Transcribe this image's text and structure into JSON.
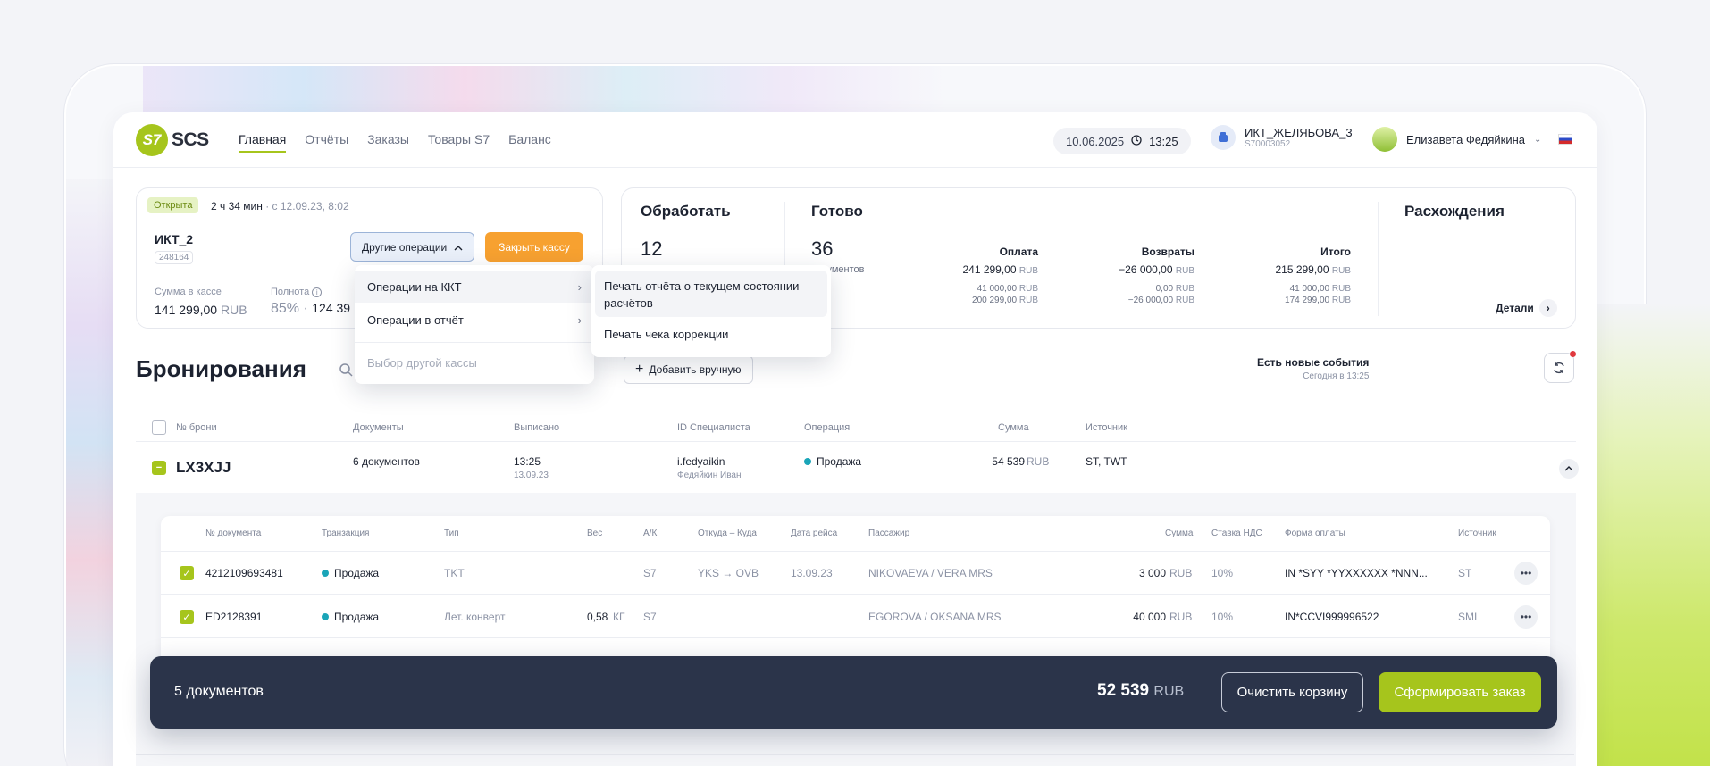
{
  "header": {
    "logo_mark": "S7",
    "logo_text": "SCS",
    "nav": [
      "Главная",
      "Отчёты",
      "Заказы",
      "Товары S7",
      "Баланс"
    ],
    "date": "10.06.2025",
    "time": "13:25",
    "kassa_name": "ИКТ_ЖЕЛЯБОВА_3",
    "kassa_id": "S70003052",
    "user_name": "Елизавета Федяйкина"
  },
  "session": {
    "status": "Открыта",
    "duration": "2 ч 34 мин",
    "since": "с 12.09.23, 8:02",
    "kassa": "ИКТ_2",
    "kassa_num": "248164",
    "other_ops": "Другие операции",
    "close_btn": "Закрыть кассу",
    "sum_label": "Сумма в кассе",
    "sum_value": "141 299,00",
    "sum_unit": "RUB",
    "full_label": "Полнота",
    "full_value": "85%",
    "full_extra": "124 39"
  },
  "stats": {
    "process_title": "Обработать",
    "process_count": "12",
    "ready_title": "Готово",
    "ready_count": "36",
    "ready_sub": "документов",
    "diff_title": "Расхождения",
    "details": "Детали",
    "columns": [
      {
        "h": "Оплата",
        "v": "241 299,00",
        "s1": "41 000,00",
        "s2": "200 299,00"
      },
      {
        "h": "Возвраты",
        "v": "−26 000,00",
        "s1": "0,00",
        "s2": "−26 000,00"
      },
      {
        "h": "Итого",
        "v": "215 299,00",
        "s1": "41 000,00",
        "s2": "174 299,00"
      }
    ],
    "unit": "RUB"
  },
  "dropdown": {
    "items": [
      "Операции на ККТ",
      "Операции в отчёт",
      "Выбор другой кассы"
    ],
    "submenu": [
      "Печать отчёта о текущем состоянии расчётов",
      "Печать чека коррекции"
    ]
  },
  "bookings": {
    "title": "Бронирования",
    "add_btn": "Добавить вручную",
    "events_title": "Есть новые события",
    "events_time": "Сегодня в 13:25",
    "columns": [
      "№ брони",
      "Документы",
      "Выписано",
      "ID Специалиста",
      "Операция",
      "Сумма",
      "Источник"
    ],
    "row": {
      "pnr": "LX3XJJ",
      "docs": "6 документов",
      "time": "13:25",
      "date": "13.09.23",
      "specialist": "i.fedyaikin",
      "specialist_name": "Федяйкин Иван",
      "operation": "Продажа",
      "sum": "54 539",
      "unit": "RUB",
      "source": "ST, TWT"
    }
  },
  "documents": {
    "columns": [
      "№ документа",
      "Транзакция",
      "Тип",
      "Вес",
      "А/К",
      "Откуда – Куда",
      "Дата рейса",
      "Пассажир",
      "Сумма",
      "Ставка НДС",
      "Форма оплаты",
      "Источник"
    ],
    "rows": [
      {
        "num": "4212109693481",
        "tx": "Продажа",
        "type": "TKT",
        "weight": "",
        "weight_unit": "",
        "ak": "S7",
        "route": "YKS → OVB",
        "date": "13.09.23",
        "pax": "NIKOVAEVA / VERA MRS",
        "sum": "3 000",
        "unit": "RUB",
        "vat": "10%",
        "pay": "IN *SYY *YYXXXXXX *NNN...",
        "src": "ST"
      },
      {
        "num": "ED2128391",
        "tx": "Продажа",
        "type": "Лет. конверт",
        "weight": "0,58",
        "weight_unit": "КГ",
        "ak": "S7",
        "route": "",
        "date": "",
        "pax": "EGOROVA / OKSANA MRS",
        "sum": "40 000",
        "unit": "RUB",
        "vat": "10%",
        "pay": "IN*CCVI999996522",
        "src": "SMI"
      }
    ]
  },
  "cart": {
    "count": "5 документов",
    "sum": "52 539",
    "unit": "RUB",
    "clear": "Очистить корзину",
    "order": "Сформировать заказ"
  }
}
